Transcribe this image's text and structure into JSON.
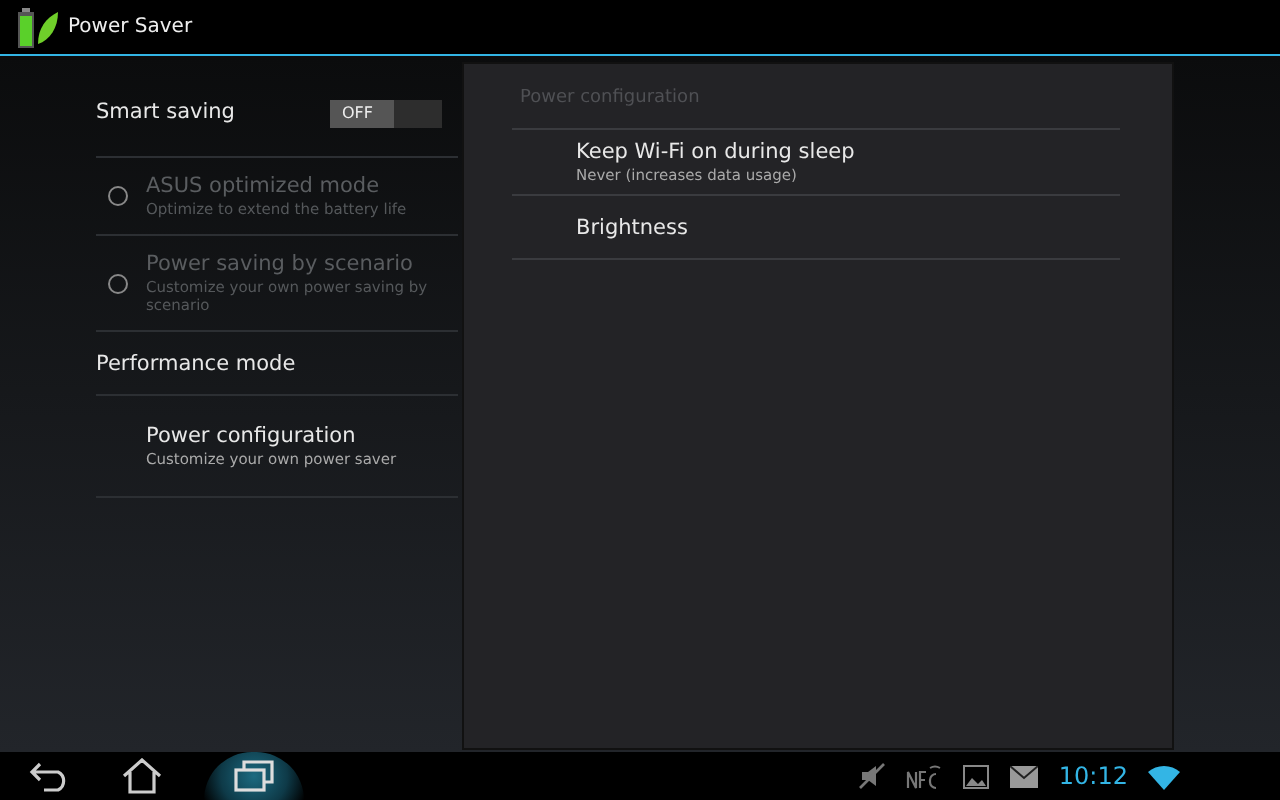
{
  "title_bar": {
    "title": "Power Saver"
  },
  "left_list": [
    {
      "kind": "toggle",
      "label": "Smart saving",
      "switch_label": "OFF",
      "on": false
    },
    {
      "kind": "radio",
      "label": "ASUS optimized mode",
      "summary": "Optimize to extend the battery life",
      "checked": false,
      "disabled": true
    },
    {
      "kind": "radio",
      "label": "Power saving by scenario",
      "summary": "Customize your own power saving by scenario",
      "checked": false,
      "disabled": true
    },
    {
      "kind": "header",
      "label": "Performance mode"
    },
    {
      "kind": "link",
      "label": "Power configuration",
      "summary": "Customize your own power saver"
    }
  ],
  "detail_panel": {
    "header": "Power configuration",
    "items": [
      {
        "label": "Keep Wi-Fi on during sleep",
        "summary": "Never (increases data usage)"
      },
      {
        "label": "Brightness"
      }
    ]
  },
  "nav_bar": {
    "buttons": [
      {
        "kind": "back",
        "selected": false
      },
      {
        "kind": "home",
        "selected": false
      },
      {
        "kind": "recent",
        "selected": true
      }
    ]
  },
  "status_bar": {
    "clock": "10:12"
  }
}
